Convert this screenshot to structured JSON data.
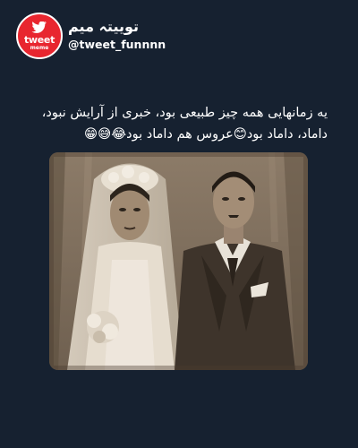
{
  "account": {
    "logo_text": "tweet",
    "logo_subtext": "meme",
    "display_name": "توییتہ میم",
    "handle": "@tweet_funnnn"
  },
  "tweet": {
    "line1": "یه زمانهایی همه چیز طبیعی بود، خبری از آرایش نبود،",
    "line2": "داماد، داماد بود😊عروس هم داماد بود😂😅😁"
  },
  "image": {
    "icon": "vintage-wedding-photo",
    "tone": "#8a7a66"
  }
}
